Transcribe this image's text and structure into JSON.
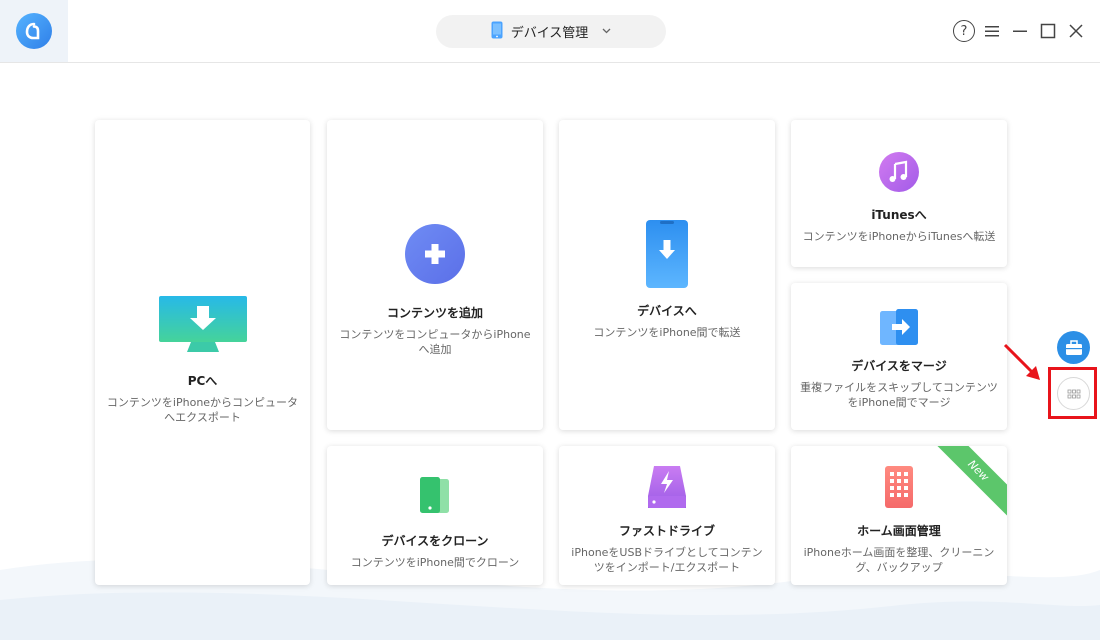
{
  "header": {
    "device_name": "デバイス管理"
  },
  "cards": {
    "pc": {
      "title": "PCへ",
      "desc": "コンテンツをiPhoneからコンピュータへエクスポート"
    },
    "add": {
      "title": "コンテンツを追加",
      "desc": "コンテンツをコンピュータからiPhoneへ追加"
    },
    "device": {
      "title": "デバイスへ",
      "desc": "コンテンツをiPhone間で転送"
    },
    "itunes": {
      "title": "iTunesへ",
      "desc": "コンテンツをiPhoneからiTunesへ転送"
    },
    "merge": {
      "title": "デバイスをマージ",
      "desc": "重複ファイルをスキップしてコンテンツをiPhone間でマージ"
    },
    "clone": {
      "title": "デバイスをクローン",
      "desc": "コンテンツをiPhone間でクローン"
    },
    "drive": {
      "title": "ファストドライブ",
      "desc": "iPhoneをUSBドライブとしてコンテンツをインポート/エクスポート"
    },
    "home": {
      "title": "ホーム画面管理",
      "desc": "iPhoneホーム画面を整理、クリーニング、バックアップ",
      "badge": "New"
    }
  },
  "icons": {
    "logo": "app-logo-icon",
    "device": "phone-icon",
    "help": "help-icon",
    "menu": "menu-icon",
    "minimize": "minimize-icon",
    "maximize": "maximize-icon",
    "close": "close-icon",
    "toolbox": "toolbox-icon",
    "more": "grid-icon"
  },
  "colors": {
    "accent": "#2f7fe8",
    "badge": "#5cc66b",
    "highlight": "#e8141b"
  }
}
